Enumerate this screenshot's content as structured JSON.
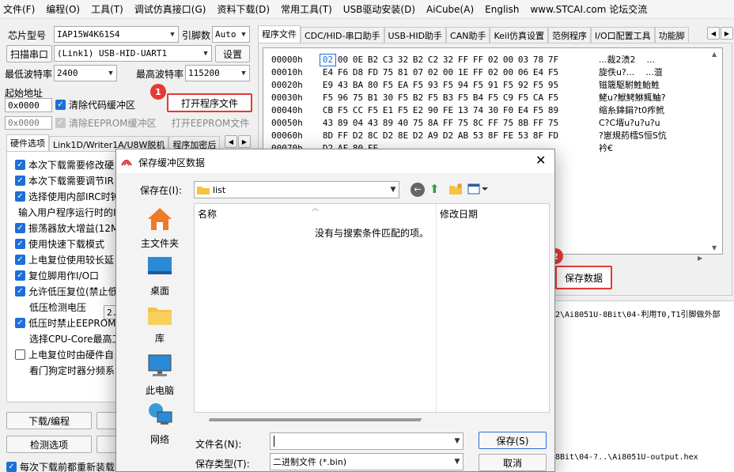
{
  "menubar": [
    "文件(F)",
    "编程(O)",
    "工具(T)",
    "调试仿真接口(G)",
    "资料下载(D)",
    "常用工具(T)",
    "USB驱动安装(D)",
    "AiCube(A)",
    "English",
    "www.STCAI.com 论坛交流"
  ],
  "left": {
    "chip_label": "芯片型号",
    "chip_value": "IAP15W4K61S4",
    "pin_label": "引脚数",
    "pin_value": "Auto",
    "scan_button": "扫描串口",
    "port_value": "(Link1) USB-HID-UART1",
    "settings_button": "设置",
    "min_baud_label": "最低波特率",
    "min_baud_value": "2400",
    "max_baud_label": "最高波特率",
    "max_baud_value": "115200",
    "start_addr_label": "起始地址",
    "addr1": "0x0000",
    "clear_code_label": "清除代码缓冲区",
    "open_program_button": "打开程序文件",
    "addr2": "0x0000",
    "clear_eeprom_label": "清除EEPROM缓冲区",
    "open_eeprom_button": "打开EEPROM文件",
    "tabs": [
      "硬件选项",
      "Link1D/Writer1A/U8W脱机",
      "程序加密后"
    ],
    "options": [
      {
        "text": "本次下载需要修改硬",
        "checked": true
      },
      {
        "text": "本次下载需要调节IR",
        "checked": true
      },
      {
        "text": "选择使用内部IRC时钟",
        "checked": true
      },
      {
        "text": "输入用户程序运行时的I",
        "checked": null
      },
      {
        "text": "振荡器放大增益(12M",
        "checked": true
      },
      {
        "text": "使用快速下载模式",
        "checked": true
      },
      {
        "text": "上电复位使用较长延",
        "checked": true
      },
      {
        "text": "复位脚用作I/O口",
        "checked": true
      },
      {
        "text": "允许低压复位(禁止低",
        "checked": true
      },
      {
        "text": "低压检测电压",
        "checked": null,
        "indent": true
      },
      {
        "text": "低压时禁止EEPROM操",
        "checked": true
      },
      {
        "text": "选择CPU-Core最高工",
        "checked": null,
        "indent": true
      },
      {
        "text": "上电复位时由硬件自",
        "checked": false
      },
      {
        "text": "看门狗定时器分频系",
        "checked": null,
        "indent": true
      }
    ],
    "lvd_value": "2.",
    "download_button": "下载/编程",
    "detect_button": "检测选项",
    "reload_label": "每次下载前都重新装载目"
  },
  "right": {
    "tabs": [
      "程序文件",
      "CDC/HID-串口助手",
      "USB-HID助手",
      "CAN助手",
      "Keil仿真设置",
      "范例程序",
      "I/O口配置工具",
      "功能脚"
    ],
    "hex_rows": [
      {
        "addr": "00000h",
        "bytes": [
          "02",
          "00",
          "0E",
          "B2",
          "C3",
          "32",
          "B2",
          "C2",
          "32",
          "FF",
          "FF",
          "02",
          "00",
          "03",
          "78",
          "7F"
        ],
        "ascii": "...裁2渍2    ..."
      },
      {
        "addr": "00010h",
        "bytes": [
          "E4",
          "F6",
          "D8",
          "FD",
          "75",
          "81",
          "07",
          "02",
          "00",
          "1E",
          "FF",
          "02",
          "00",
          "06",
          "E4",
          "F5"
        ],
        "ascii": "旋佚u?...    ...潉"
      },
      {
        "addr": "00020h",
        "bytes": [
          "E9",
          "43",
          "BA",
          "80",
          "F5",
          "EA",
          "F5",
          "93",
          "F5",
          "94",
          "F5",
          "91",
          "F5",
          "92",
          "F5",
          "95"
        ],
        "ascii": "镃簚駆駙鮏鮐鮏"
      },
      {
        "addr": "00030h",
        "bytes": [
          "F5",
          "96",
          "75",
          "B1",
          "30",
          "F5",
          "B2",
          "F5",
          "B3",
          "F5",
          "B4",
          "F5",
          "C9",
          "F5",
          "CA",
          "F5"
        ],
        "ascii": "鮱u?鮲鮳鮴鮿鮋?"
      },
      {
        "addr": "00040h",
        "bytes": [
          "CB",
          "F5",
          "CC",
          "F5",
          "E1",
          "F5",
          "E2",
          "90",
          "FE",
          "13",
          "74",
          "30",
          "F0",
          "E4",
          "F5",
          "89"
        ],
        "ascii": "缩糸鋛鋗?t0痄鮘"
      },
      {
        "addr": "00050h",
        "bytes": [
          "43",
          "89",
          "04",
          "43",
          "89",
          "40",
          "75",
          "8A",
          "FF",
          "75",
          "8C",
          "FF",
          "75",
          "8B",
          "FF",
          "75"
        ],
        "ascii": "C?C壻u?u?u?u"
      },
      {
        "addr": "00060h",
        "bytes": [
          "8D",
          "FF",
          "D2",
          "8C",
          "D2",
          "8E",
          "D2",
          "A9",
          "D2",
          "AB",
          "53",
          "8F",
          "FE",
          "53",
          "8F",
          "FD"
        ],
        "ascii": "?崽規葯樰S恒S忼"
      },
      {
        "addr": "00070h",
        "bytes": [
          "D2",
          "AF",
          "80",
          "FE"
        ],
        "ascii": "衿€"
      }
    ],
    "save_data_button": "保存数据",
    "path_line1": "2\\Ai8051U-8Bit\\04-利用T0,T1引脚做外部",
    "path_line2": "8Bit\\04-?..\\Ai8051U-output.hex"
  },
  "badges": [
    "1",
    "2"
  ],
  "dialog": {
    "title": "保存缓冲区数据",
    "save_in_label": "保存在(I):",
    "folder": "list",
    "places": [
      {
        "label": "主文件夹",
        "icon": "home-icon"
      },
      {
        "label": "桌面",
        "icon": "desktop-icon"
      },
      {
        "label": "库",
        "icon": "library-folder-icon"
      },
      {
        "label": "此电脑",
        "icon": "computer-icon"
      },
      {
        "label": "网络",
        "icon": "network-icon"
      }
    ],
    "col_name": "名称",
    "col_date": "修改日期",
    "empty_message": "没有与搜索条件匹配的项。",
    "filename_label": "文件名(N):",
    "filename_value": "",
    "filetype_label": "保存类型(T):",
    "filetype_value": "二进制文件 (*.bin)",
    "save_button": "保存(S)",
    "cancel_button": "取消"
  },
  "colors": {
    "accent": "#1e6fd9",
    "highlight": "#e53935",
    "folder": "#f5c342"
  }
}
